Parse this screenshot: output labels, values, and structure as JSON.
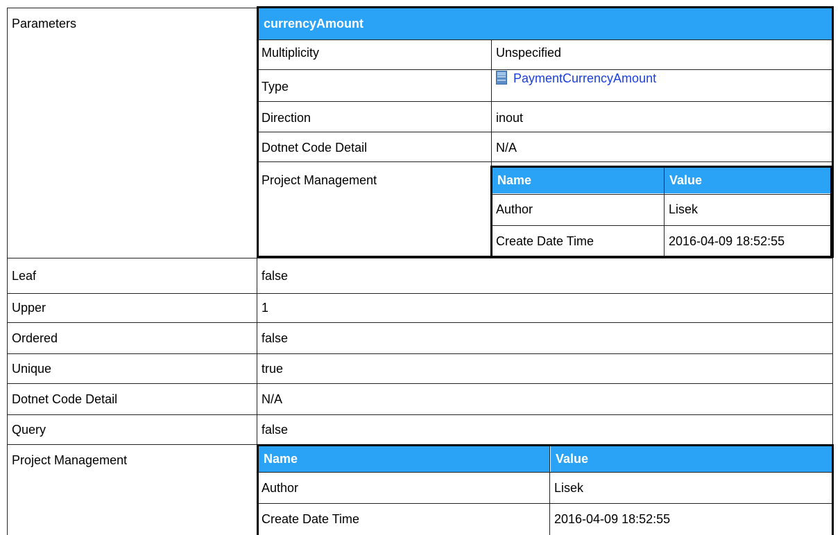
{
  "params_label": "Parameters",
  "param": {
    "name": "currencyAmount",
    "rows": [
      {
        "label": "Multiplicity",
        "value": "Unspecified"
      },
      {
        "label": "Type",
        "value": "PaymentCurrencyAmount",
        "icon": "class-icon"
      },
      {
        "label": "Direction",
        "value": "inout"
      },
      {
        "label": "Dotnet Code Detail",
        "value": "N/A"
      }
    ],
    "pm": {
      "label": "Project Management",
      "headers": [
        "Name",
        "Value"
      ],
      "rows": [
        [
          "Author",
          "Lisek"
        ],
        [
          "Create Date Time",
          "2016-04-09 18:52:55"
        ]
      ]
    }
  },
  "rows": [
    {
      "label": "Leaf",
      "value": "false"
    },
    {
      "label": "Upper",
      "value": "1"
    },
    {
      "label": "Ordered",
      "value": "false"
    },
    {
      "label": "Unique",
      "value": "true"
    },
    {
      "label": "Dotnet Code Detail",
      "value": "N/A"
    },
    {
      "label": "Query",
      "value": "false"
    }
  ],
  "pm": {
    "label": "Project Management",
    "headers": [
      "Name",
      "Value"
    ],
    "rows": [
      [
        "Author",
        "Lisek"
      ],
      [
        "Create Date Time",
        "2016-04-09 18:52:55"
      ]
    ]
  },
  "colors": {
    "header_bg": "#2aa2f5",
    "link": "#1a3fe0"
  }
}
